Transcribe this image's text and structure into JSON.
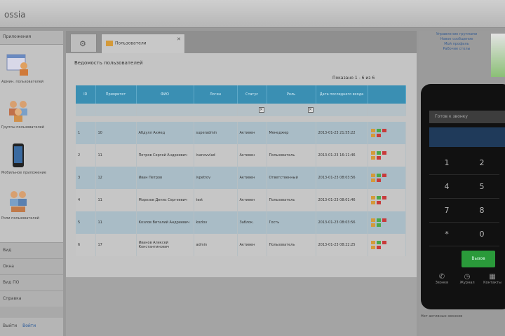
{
  "app": {
    "title": "ossia"
  },
  "sidebar": {
    "header": "Приложения",
    "apps": [
      {
        "label": "Админ. пользователей",
        "icon": "user-admin-icon"
      },
      {
        "label": "Группы пользователей",
        "icon": "user-group-icon"
      },
      {
        "label": "Мобильное приложение",
        "icon": "smartphone-icon"
      },
      {
        "label": "Роли пользователей",
        "icon": "user-roles-icon"
      }
    ],
    "sections": [
      "Вид",
      "Окна",
      "Вид ПО",
      "Справка"
    ],
    "footer": {
      "label": "Выйти",
      "link": "Войти"
    }
  },
  "tabs": [
    {
      "label": "Пользователи"
    }
  ],
  "panel": {
    "title": "Ведомость пользователей",
    "records": "Показано 1 - 6 из 6"
  },
  "table": {
    "columns": [
      "ID",
      "Приоритет",
      "ФИО",
      "Логин",
      "Статус",
      "Роль",
      "Дата последнего входа",
      ""
    ],
    "rows": [
      {
        "id": "1",
        "priority": "10",
        "name": "Абдулл Ахмед",
        "login": "superadmin",
        "status": "Активен",
        "role": "Менеджер",
        "date": "2013-01-23 21:55:22"
      },
      {
        "id": "2",
        "priority": "11",
        "name": "Петров Сергей Андреевич",
        "login": "ivanovvlad",
        "status": "Активен",
        "role": "Пользователь",
        "date": "2013-01-23 16:11:46"
      },
      {
        "id": "3",
        "priority": "12",
        "name": "Иван Петров",
        "login": "ivpetrov",
        "status": "Активен",
        "role": "Ответственный",
        "date": "2013-01-23 08:03:56"
      },
      {
        "id": "4",
        "priority": "11",
        "name": "Морозов Денис Сергеевич",
        "login": "test",
        "status": "Активен",
        "role": "Пользователь",
        "date": "2013-01-23 08:01:46"
      },
      {
        "id": "5",
        "priority": "11",
        "name": "Козлов Виталий Андреевич",
        "login": "kozlov",
        "status": "Заблок.",
        "role": "Гость",
        "date": "2013-01-23 08:03:56"
      },
      {
        "id": "6",
        "priority": "17",
        "name": "Иванов Алексей Константинович",
        "login": "admin",
        "status": "Активен",
        "role": "Пользователь",
        "date": "2013-01-23 08:22:25"
      }
    ]
  },
  "right": {
    "links": [
      "Управление группами",
      "Новое сообщение",
      "Мой профиль",
      "Рабочие столы"
    ],
    "phone": {
      "status": "Готов к звонку",
      "keys": [
        "1",
        "2",
        "4",
        "5",
        "7",
        "8",
        "*",
        "0"
      ],
      "call": "Вызов",
      "nav": [
        {
          "label": "Звонки",
          "icon": "phone-icon"
        },
        {
          "label": "Журнал",
          "icon": "history-icon"
        },
        {
          "label": "Контакты",
          "icon": "contacts-icon"
        }
      ]
    },
    "caption": "Нет активных звонков"
  },
  "colors": {
    "header_blue": "#3a8fb3",
    "row_blue": "#a9bcc6",
    "call_green": "#2a9a3a",
    "icon_orange": "#d49a3a",
    "icon_red": "#c83a3a",
    "icon_green": "#4aa84a"
  }
}
